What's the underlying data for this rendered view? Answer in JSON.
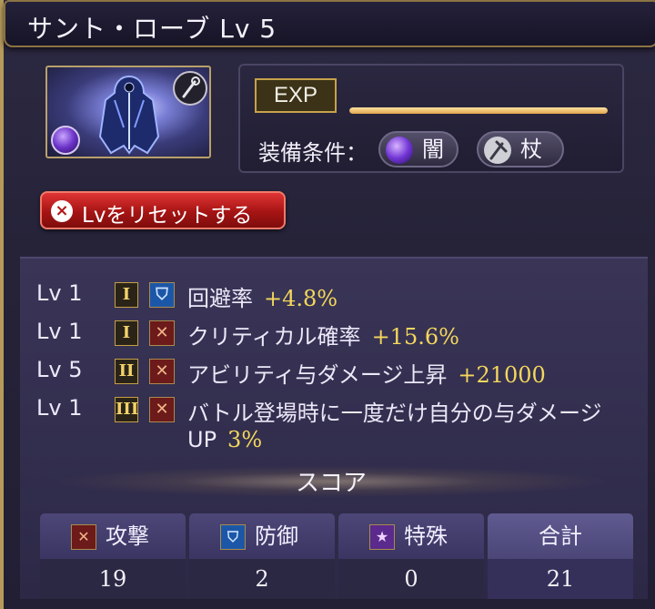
{
  "window": {
    "title": "サント・ローブ Lv 5"
  },
  "item": {
    "image_icon": "robe-icon",
    "element_icon": "dark-element-icon",
    "weapon_icon": "staff-icon"
  },
  "exp": {
    "label": "EXP",
    "progress_fraction": 1.0
  },
  "equip": {
    "label": "装備条件：",
    "element": "闇",
    "weapon": "杖"
  },
  "reset_button": {
    "label": "Lvをリセットする"
  },
  "abilities": [
    {
      "lv": "Lv 1",
      "tier": "I",
      "type": "defense",
      "name": "回避率",
      "value": "+4.8%"
    },
    {
      "lv": "Lv 1",
      "tier": "I",
      "type": "attack",
      "name": "クリティカル確率",
      "value": "+15.6%"
    },
    {
      "lv": "Lv 5",
      "tier": "II",
      "type": "attack",
      "name": "アビリティ与ダメージ上昇",
      "value": "+21000"
    },
    {
      "lv": "Lv 1",
      "tier": "III",
      "type": "attack",
      "name": "バトル登場時に一度だけ自分の与ダメージ",
      "name_line2": "UP",
      "value": "3%"
    }
  ],
  "score": {
    "title": "スコア",
    "columns": [
      {
        "label": "攻撃",
        "icon": "attack-icon",
        "value": "19"
      },
      {
        "label": "防御",
        "icon": "defense-icon",
        "value": "2"
      },
      {
        "label": "特殊",
        "icon": "special-icon",
        "value": "0"
      },
      {
        "label": "合計",
        "icon": "",
        "value": "21"
      }
    ]
  },
  "colors": {
    "accent_gold": "#c6a24c",
    "value_yellow": "#f3d75c",
    "reset_red": "#c01f1f",
    "panel": "#2c2846"
  }
}
